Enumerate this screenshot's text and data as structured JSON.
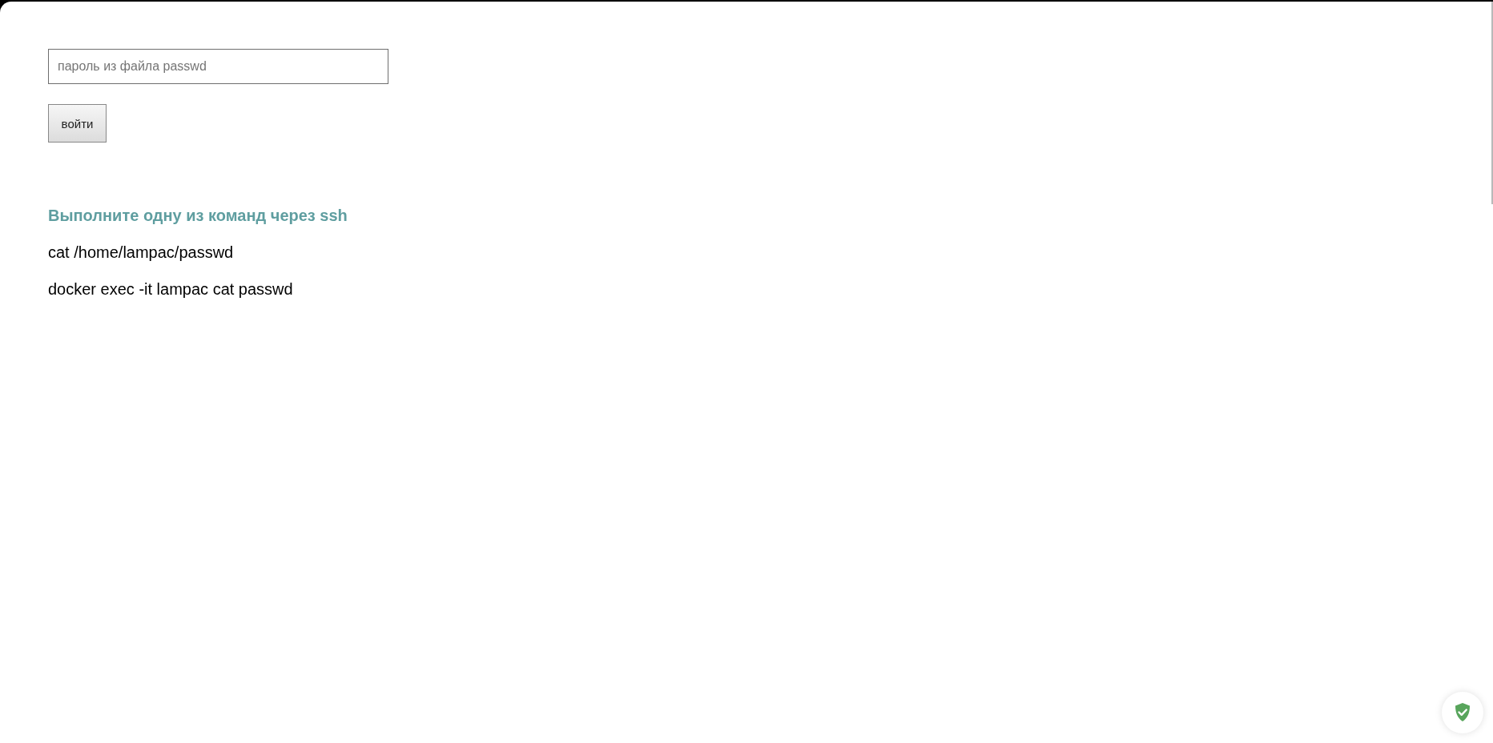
{
  "login_form": {
    "password_field": {
      "placeholder": "пароль из файла passwd"
    },
    "submit_button": {
      "label": "войти"
    }
  },
  "instructions": {
    "heading": "Выполните одну из команд через ssh",
    "commands": [
      "cat /home/lampac/passwd",
      "docker exec -it lampac cat passwd"
    ]
  }
}
